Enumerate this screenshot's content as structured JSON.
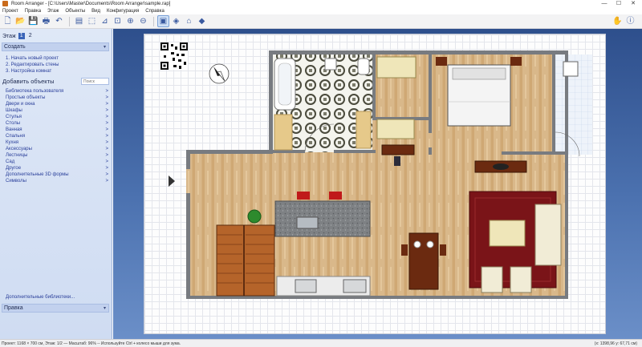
{
  "window": {
    "title": "Room Arranger - [C:\\Users\\Master\\Documents\\Room Arranger\\sample.rap]",
    "minimize": "—",
    "maximize": "☐",
    "close": "✕"
  },
  "menu": [
    "Проект",
    "Правка",
    "Этаж",
    "Объекты",
    "Вид",
    "Конфигурация",
    "Справка"
  ],
  "sidebar": {
    "floor_label": "Этаж",
    "floor_tabs": [
      "1",
      "2"
    ],
    "create_title": "Создать",
    "steps": [
      "1. Начать новый проект",
      "2. Редактировать стены",
      "3. Настройка комнат"
    ],
    "add_objects_title": "Добавить объекты",
    "search_placeholder": "Поиск",
    "libraries": [
      "Библиотека пользователя",
      "Простые объекты",
      "Двери и окна",
      "Шкафы",
      "Стулья",
      "Столы",
      "Ванная",
      "Спальня",
      "Кухня",
      "Аксессуары",
      "Лестницы",
      "Сад",
      "Другое",
      "Дополнительные 3D формы",
      "Символы"
    ],
    "arrow": ">",
    "more_libraries": "Дополнительные библиотеки...",
    "edit_title": "Правка",
    "chevron": "▾"
  },
  "status": {
    "left": "Проект: 1168 × 700 см, Этаж: 1/2 — Масштаб: 96% -- Используйте Ctrl + колесо мыши для зума.",
    "right": "(x: 1398,96 y: 67,71 см)"
  },
  "icons": {
    "toolbar": [
      "new-file-icon",
      "open-folder-icon",
      "save-icon",
      "print-icon",
      "undo-icon",
      "wall-tool-icon",
      "selection-tool-icon",
      "measure-icon",
      "zoom-fit-icon",
      "zoom-in-icon",
      "zoom-out-icon",
      "view-2d-icon",
      "view-3d-icon",
      "render-3d-icon",
      "object-3d-icon",
      "help-icon"
    ]
  },
  "colors": {
    "canvas_bg": "#3a5e9e",
    "sidebar_bg": "#d9e3f5",
    "accent": "#3a64b8",
    "floor_wood": "#d9b88a",
    "rug": "#7a1418",
    "sofa": "#f1ecd6"
  }
}
